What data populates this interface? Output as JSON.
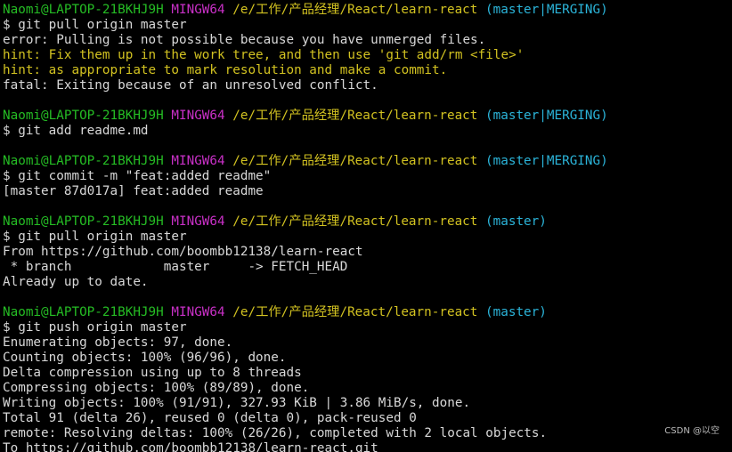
{
  "colors": {
    "background": "#000000",
    "user_host": "#25bc24",
    "mingw": "#c930c7",
    "path": "#d2c221",
    "branch_status": "#2bb4d9",
    "hint": "#d2c221",
    "output": "#d8d8d8"
  },
  "prompt": {
    "user_host": "Naomi@LAPTOP-21BKHJ9H",
    "env": "MINGW64",
    "path": "/e/工作/产品经理/React/learn-react"
  },
  "blocks": [
    {
      "branch": "(master|MERGING)",
      "command": "$ git pull origin master",
      "output": [
        {
          "type": "out",
          "text": "error: Pulling is not possible because you have unmerged files."
        },
        {
          "type": "hint",
          "text": "hint: Fix them up in the work tree, and then use 'git add/rm <file>'"
        },
        {
          "type": "hint",
          "text": "hint: as appropriate to mark resolution and make a commit."
        },
        {
          "type": "out",
          "text": "fatal: Exiting because of an unresolved conflict."
        }
      ]
    },
    {
      "branch": "(master|MERGING)",
      "command": "$ git add readme.md",
      "output": []
    },
    {
      "branch": "(master|MERGING)",
      "command": "$ git commit -m \"feat:added readme\"",
      "output": [
        {
          "type": "out",
          "text": "[master 87d017a] feat:added readme"
        }
      ]
    },
    {
      "branch": "(master)",
      "command": "$ git pull origin master",
      "output": [
        {
          "type": "out",
          "text": "From https://github.com/boombb12138/learn-react"
        },
        {
          "type": "out",
          "text": " * branch            master     -> FETCH_HEAD"
        },
        {
          "type": "out",
          "text": "Already up to date."
        }
      ]
    },
    {
      "branch": "(master)",
      "command": "$ git push origin master",
      "output": [
        {
          "type": "out",
          "text": "Enumerating objects: 97, done."
        },
        {
          "type": "out",
          "text": "Counting objects: 100% (96/96), done."
        },
        {
          "type": "out",
          "text": "Delta compression using up to 8 threads"
        },
        {
          "type": "out",
          "text": "Compressing objects: 100% (89/89), done."
        },
        {
          "type": "out",
          "text": "Writing objects: 100% (91/91), 327.93 KiB | 3.86 MiB/s, done."
        },
        {
          "type": "out",
          "text": "Total 91 (delta 26), reused 0 (delta 0), pack-reused 0"
        },
        {
          "type": "out",
          "text": "remote: Resolving deltas: 100% (26/26), completed with 2 local objects."
        },
        {
          "type": "out",
          "text": "To https://github.com/boombb12138/learn-react.git"
        }
      ]
    }
  ],
  "watermark": "CSDN @以空"
}
